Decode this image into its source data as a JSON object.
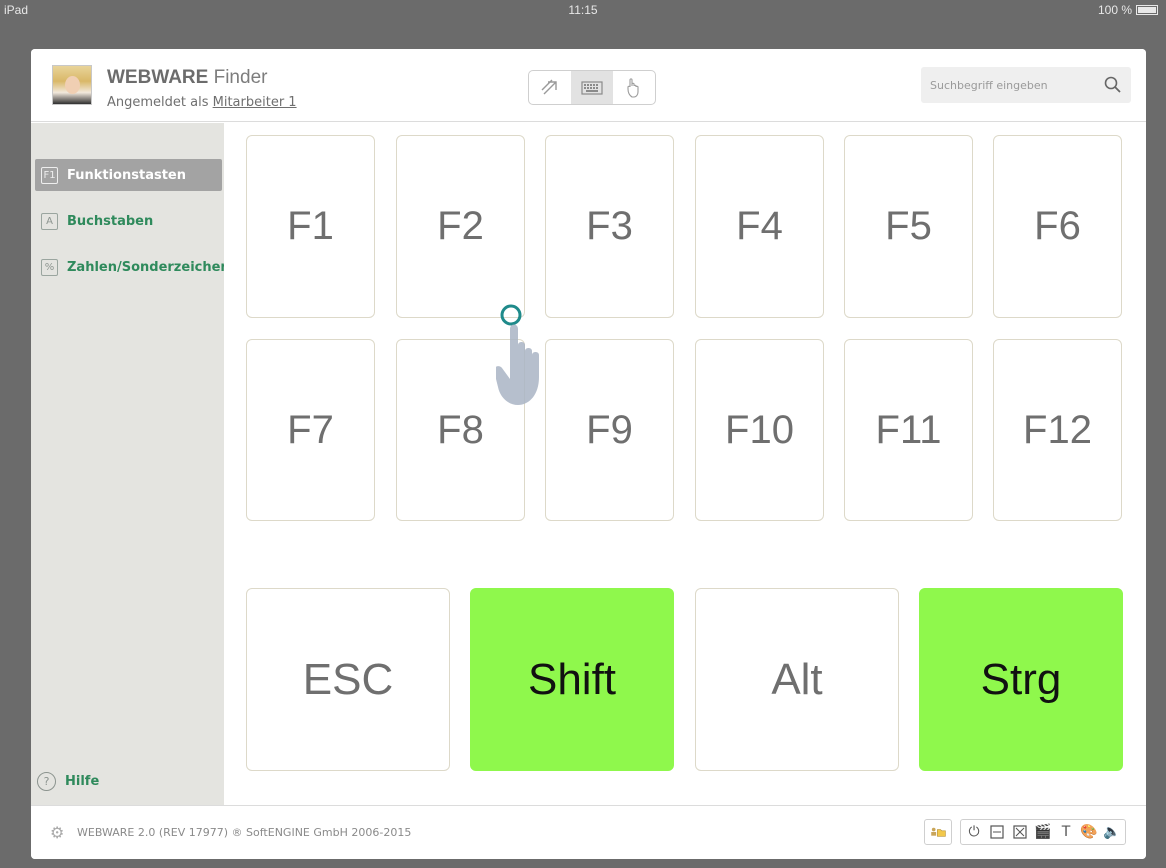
{
  "status_bar": {
    "device": "iPad",
    "time": "11:15",
    "battery": "100 %"
  },
  "header": {
    "brand_bold": "WEBWARE",
    "brand_rest": " Finder",
    "login_prefix": "Angemeldet als ",
    "login_user": "Mitarbeiter 1",
    "search_placeholder": "Suchbegriff eingeben",
    "modes": [
      {
        "icon": "pointer-arrow-icon",
        "active": false
      },
      {
        "icon": "keyboard-icon",
        "active": true
      },
      {
        "icon": "hand-touch-icon",
        "active": false
      }
    ]
  },
  "sidebar": {
    "items": [
      {
        "badge": "F1",
        "label": "Funktionstasten",
        "active": true
      },
      {
        "badge": "A",
        "label": "Buchstaben",
        "active": false
      },
      {
        "badge": "%",
        "label": "Zahlen/Sonderzeichen",
        "active": false
      }
    ],
    "help_label": "Hilfe",
    "help_icon": "?"
  },
  "keys": {
    "function_row_1": [
      "F1",
      "F2",
      "F3",
      "F4",
      "F5",
      "F6"
    ],
    "function_row_2": [
      "F7",
      "F8",
      "F9",
      "F10",
      "F11",
      "F12"
    ],
    "modifiers": [
      {
        "label": "ESC",
        "active": false
      },
      {
        "label": "Shift",
        "active": true
      },
      {
        "label": "Alt",
        "active": false
      },
      {
        "label": "Strg",
        "active": true
      }
    ],
    "active_color": "#8ff84c"
  },
  "footer": {
    "copyright": "WEBWARE 2.0 (REV 17977) ® SoftENGINE GmbH 2006-2015"
  }
}
